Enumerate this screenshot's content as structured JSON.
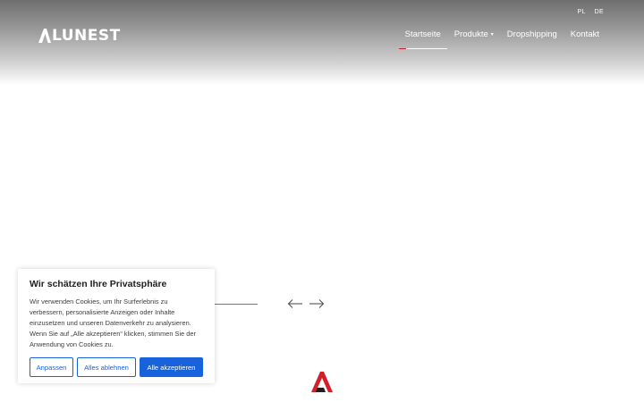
{
  "brand": {
    "logo_text": "LUNEST",
    "accent_color": "#d0202a"
  },
  "languages": [
    "PL",
    "DE"
  ],
  "nav": {
    "items": [
      "Startseite",
      "Produkte",
      "Dropshipping",
      "Kontakt"
    ],
    "active": "Startseite",
    "caret": "▾"
  },
  "slider": {
    "prev_icon": "arrow-left-icon",
    "next_icon": "arrow-right-icon"
  },
  "cookie": {
    "title": "Wir schätzen Ihre Privatsphäre",
    "text": "Wir verwenden Cookies, um Ihr Surferlebnis zu verbessern, personalisierte Anzeigen oder Inhalte einzusetzen und unseren Datenverkehr zu analysieren. Wenn Sie auf „Alle akzeptieren“ klicken, stimmen Sie der Anwendung von Cookies zu.",
    "buttons": {
      "customize": "Anpassen",
      "reject": "Alles ablehnen",
      "accept": "Alle akzeptieren"
    },
    "button_color": "#1863dc"
  }
}
